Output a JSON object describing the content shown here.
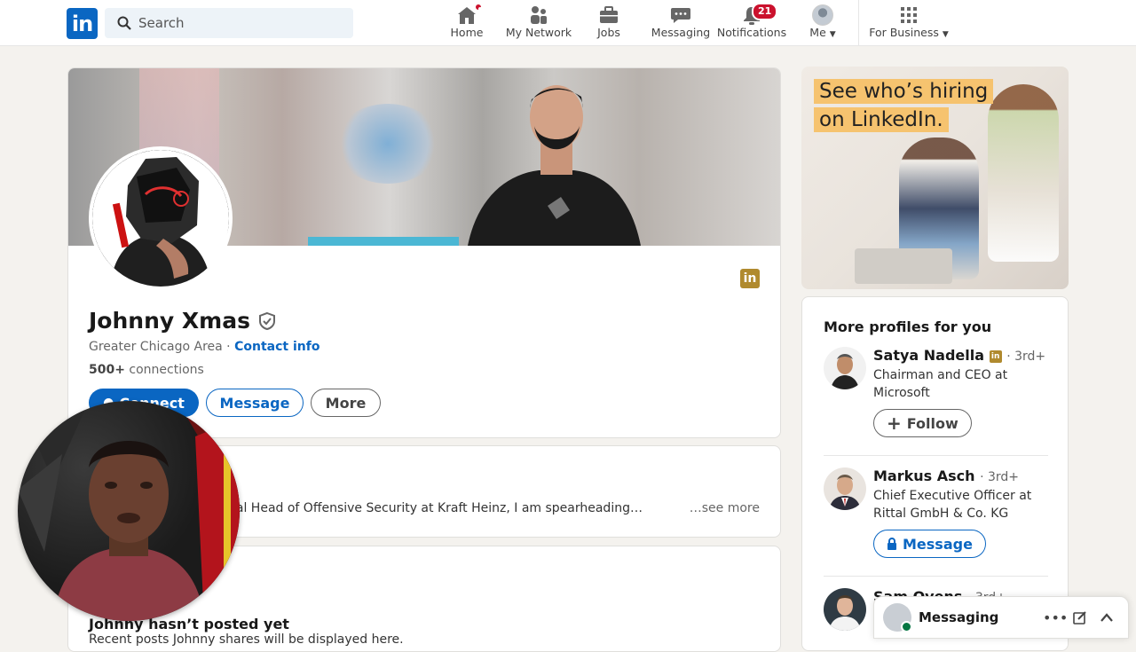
{
  "nav": {
    "search_placeholder": "Search",
    "items": [
      {
        "label": "Home",
        "icon": "home-icon"
      },
      {
        "label": "My Network",
        "icon": "network-icon"
      },
      {
        "label": "Jobs",
        "icon": "briefcase-icon"
      },
      {
        "label": "Messaging",
        "icon": "messaging-icon"
      },
      {
        "label": "Notifications",
        "icon": "bell-icon",
        "badge": "21"
      },
      {
        "label": "Me",
        "icon": "avatar"
      },
      {
        "label": "For Business",
        "icon": "grid-icon"
      }
    ]
  },
  "profile": {
    "name": "Johnny Xmas",
    "location": "Greater Chicago Area",
    "contact_info": "Contact info",
    "connections_count": "500+",
    "connections_label": "connections",
    "connect_label": "Connect",
    "message_label": "Message",
    "more_label": "More"
  },
  "about": {
    "text": "bal Head of Offensive Security at Kraft Heinz, I am spearheading…",
    "see_more": "…see more"
  },
  "activity": {
    "title": "Johnny hasn’t posted yet",
    "subtitle": "Recent posts Johnny shares will be displayed here."
  },
  "ad": {
    "line1": "See who’s hiring",
    "line2": "on LinkedIn."
  },
  "sidebar": {
    "title": "More profiles for you",
    "profiles": [
      {
        "name": "Satya Nadella",
        "degree": "· 3rd+",
        "headline": "Chairman and CEO at Microsoft",
        "action": "Follow"
      },
      {
        "name": "Markus Asch",
        "degree": "· 3rd+",
        "headline": "Chief Executive Officer at Rittal GmbH & Co. KG",
        "action": "Message"
      },
      {
        "name": "Sam Ovens",
        "degree": "· 3rd+"
      }
    ]
  },
  "messaging": {
    "label": "Messaging"
  },
  "colors": {
    "brand": "#0a66c2",
    "notification": "#cb112d",
    "background": "#f4f2ee"
  }
}
